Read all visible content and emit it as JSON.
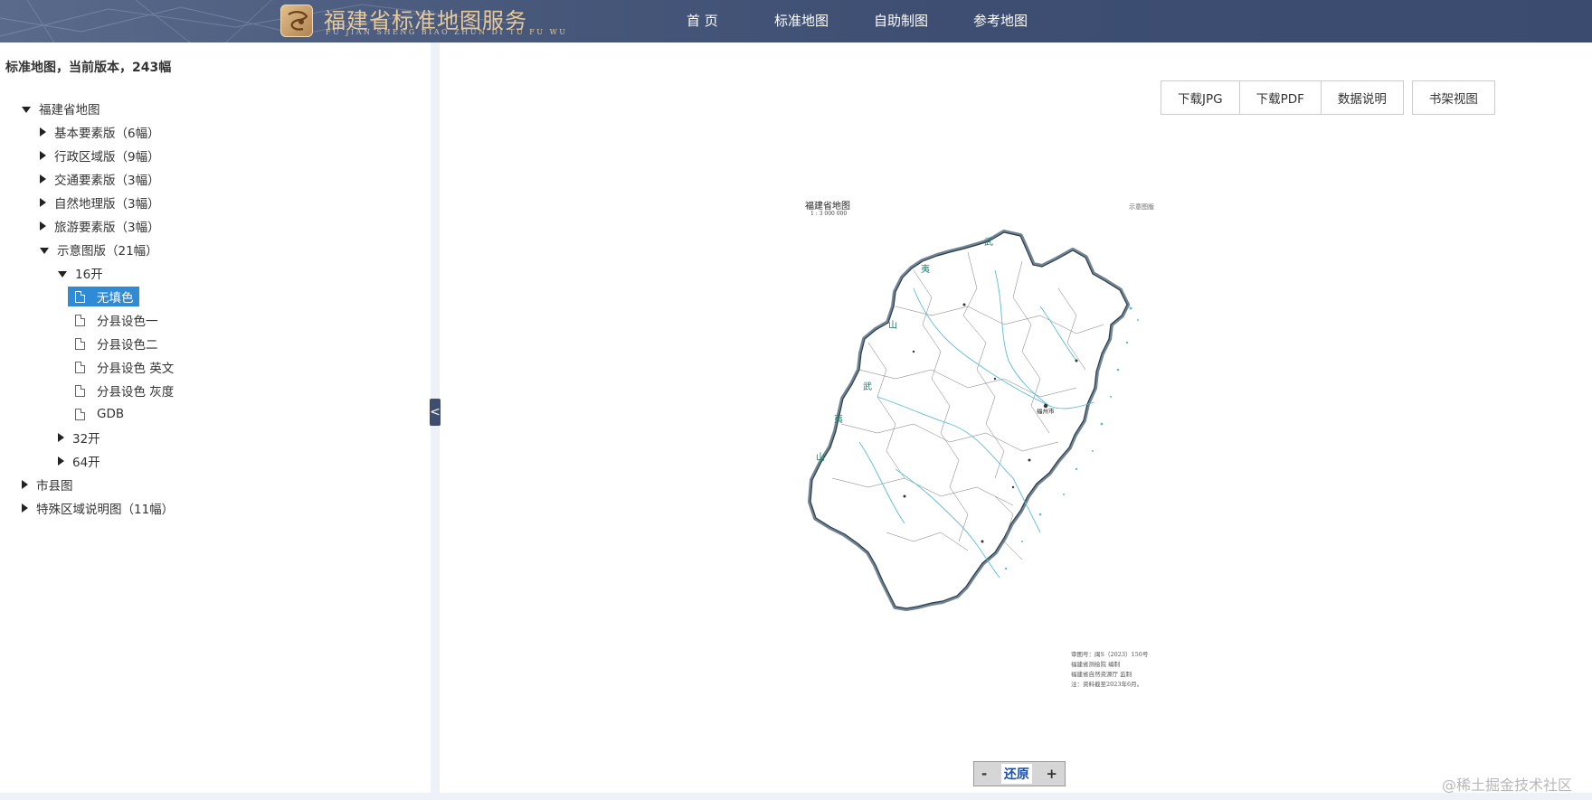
{
  "header": {
    "title": "福建省标准地图服务",
    "subtitle": "FU JIAN SHENG BIAO ZHUN DI TU FU WU",
    "logo_icon": "site-logo-icon",
    "nav": [
      {
        "label": "首 页"
      },
      {
        "label": "标准地图"
      },
      {
        "label": "自助制图"
      },
      {
        "label": "参考地图"
      }
    ]
  },
  "sidebar": {
    "summary": "标准地图，当前版本，243幅",
    "tree": [
      {
        "label": "福建省地图",
        "expanded": true
      },
      {
        "label": "基本要素版（6幅）"
      },
      {
        "label": "行政区域版（9幅）"
      },
      {
        "label": "交通要素版（3幅）"
      },
      {
        "label": "自然地理版（3幅）"
      },
      {
        "label": "旅游要素版（3幅）"
      },
      {
        "label": "示意图版（21幅）",
        "expanded": true
      },
      {
        "label": "16开",
        "expanded": true
      },
      {
        "label": "无填色",
        "selected": true
      },
      {
        "label": "分县设色一"
      },
      {
        "label": "分县设色二"
      },
      {
        "label": "分县设色 英文"
      },
      {
        "label": "分县设色 灰度"
      },
      {
        "label": "GDB"
      },
      {
        "label": "32开"
      },
      {
        "label": "64开"
      },
      {
        "label": "市县图"
      },
      {
        "label": "特殊区域说明图（11幅）"
      }
    ],
    "collapse_label": "<"
  },
  "toolbar": {
    "download_jpg": "下载JPG",
    "download_pdf": "下载PDF",
    "data_info": "数据说明",
    "shelf_view": "书架视图"
  },
  "map": {
    "title": "福建省地图",
    "scale": "1 : 3 000 000",
    "legend_label": "示意图版",
    "capital_label": "福州市",
    "note_lines": [
      "审图号：闽S（2023）150号",
      "福建省测绘院 编制",
      "福建省自然资源厅 监制",
      "注：资料截至2023年6月。"
    ]
  },
  "zoom": {
    "minus": "-",
    "reset": "还原",
    "plus": "+"
  },
  "watermark": "@稀土掘金技术社区",
  "colors": {
    "header_bg": "#3d4e72",
    "header_title": "#e7c999",
    "selected_bg": "#2f8bd6",
    "map_river": "#5bbbd6",
    "map_outline": "#5a6f80"
  }
}
